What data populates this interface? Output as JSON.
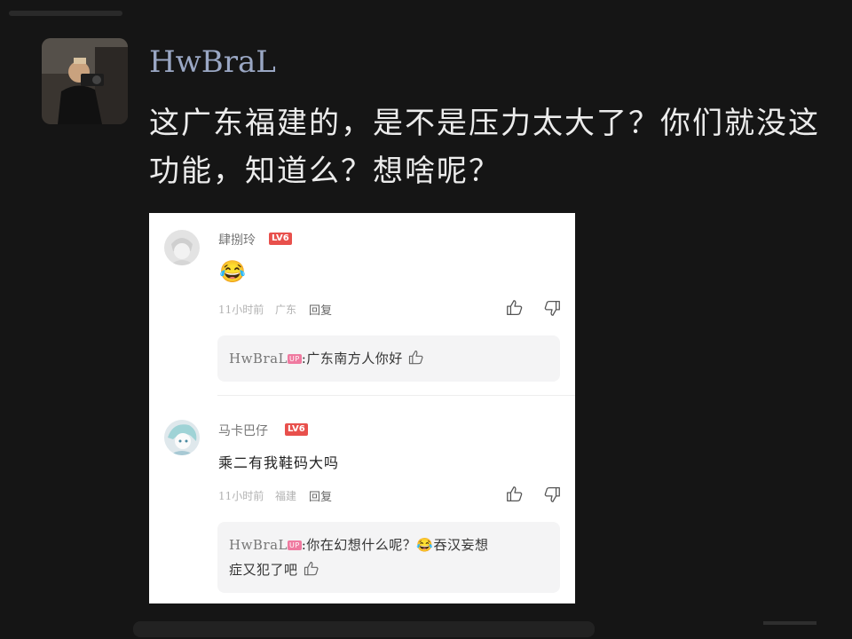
{
  "post": {
    "username": "HwBraL",
    "text": "这广东福建的，是不是压力太大了？你们就没这功能，知道么？想啥呢？"
  },
  "comments": [
    {
      "name": "肆捌玲",
      "level": "LV6",
      "text": "😂",
      "time": "11小时前",
      "location": "广东",
      "reply_label": "回复",
      "reply": {
        "author": "HwBraL",
        "badge": "UP",
        "text": ":广东南方人你好",
        "text_cont": ""
      }
    },
    {
      "name": "马卡巴仔",
      "level": "LV6",
      "text": "乘二有我鞋码大吗",
      "time": "11小时前",
      "location": "福建",
      "reply_label": "回复",
      "reply": {
        "author": "HwBraL",
        "badge": "UP",
        "text": ":你在幻想什么呢？😂吞汉妄想",
        "text_cont": "症又犯了吧"
      }
    }
  ],
  "icons": [
    "like-icon",
    "dislike-icon",
    "reply-like-icon"
  ]
}
